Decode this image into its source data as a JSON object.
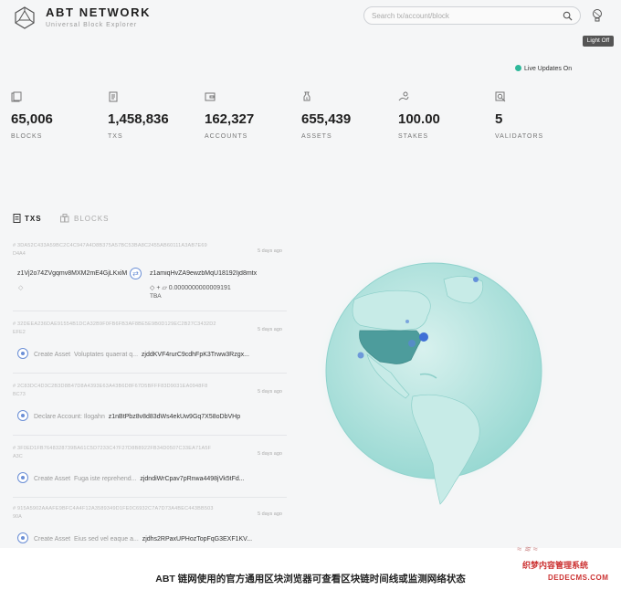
{
  "header": {
    "brand": "ABT NETWORK",
    "brand_subtitle": "Universal Block Explorer",
    "search_placeholder": "Search tx/account/block",
    "light_toggle": "Light Off"
  },
  "live_updates": "Live Updates On",
  "colors": {
    "live_dot": "#2fb89a",
    "accent": "#6b8fd6",
    "globe": "#7fcfcc"
  },
  "stats": [
    {
      "icon": "block-icon",
      "value": "65,006",
      "label": "BLOCKS"
    },
    {
      "icon": "document-icon",
      "value": "1,458,836",
      "label": "TXS"
    },
    {
      "icon": "wallet-icon",
      "value": "162,327",
      "label": "ACCOUNTS"
    },
    {
      "icon": "asset-bag-icon",
      "value": "655,439",
      "label": "ASSETS"
    },
    {
      "icon": "stake-icon",
      "value": "100.00",
      "label": "STAKES"
    },
    {
      "icon": "validator-icon",
      "value": "5",
      "label": "VALIDATORS"
    }
  ],
  "tabs": [
    {
      "label": "TXS",
      "active": true
    },
    {
      "label": "BLOCKS",
      "active": false
    }
  ],
  "transactions": [
    {
      "hash": "# 3DA52C433A59BC2C4C947A4D8B375A57BC53BA8C2455AB60111A3AB7E69",
      "short": "D4A4",
      "time": "5 days ago",
      "from": "z1Vj2o74ZVgqmv8MXM2mE4GjLKxiM",
      "to": "z1amiqHvZA9ewzbMqU18192Ijd8mtx",
      "amount": "0.0000000000009191",
      "currency": "TBA"
    },
    {
      "hash": "# 32DEEA236DAE91554B1DCA32B9F0FB6FB3AF8BE5E9B0D129EC2B27C3432D2",
      "short": "EFE2",
      "time": "5 days ago",
      "type": "Create Asset",
      "desc": "Voluptates quaerat q...",
      "addr": "zjddKVF4rurC9cdhFpK3Trww3Rzgx..."
    },
    {
      "hash": "# 2C83DC4D3C2B3D8B47D8A4393E63A43B6D8F67D5BFFF83D9031EA0948F8",
      "short": "BC73",
      "time": "5 days ago",
      "type": "Declare Account",
      "desc": "Ilogahn",
      "addr": "z1nBtPbz8v8d83dWs4ekUw9Gq7X58oDbVHp"
    },
    {
      "hash": "# 3F0ED1FB7648328739BA61C5D7233C47F27D8B8922FB34D0507C33EA71A5F",
      "short": "A3C",
      "time": "5 days ago",
      "type": "Create Asset",
      "desc": "Fuga iste reprehend...",
      "addr": "zjdndiWrCpav7pRnwa4498jVk5tFd..."
    },
    {
      "hash": "# 915A5902AAAFE9BFC4A4F12A3589349D1FE0C6932C7A7D73A4BEC443BB503",
      "short": "90A",
      "time": "5 days ago",
      "type": "Create Asset",
      "desc": "Eius sed vel eaque a...",
      "addr": "zjdhs2RPaxUPHozTopFqG3EXF1KV..."
    }
  ],
  "caption": "ABT 链网使用的官方通用区块浏览器可查看区块链时间线或监测网络状态",
  "watermark": {
    "line1": "织梦内容管理系统",
    "line2": "DEDECMS.COM"
  }
}
